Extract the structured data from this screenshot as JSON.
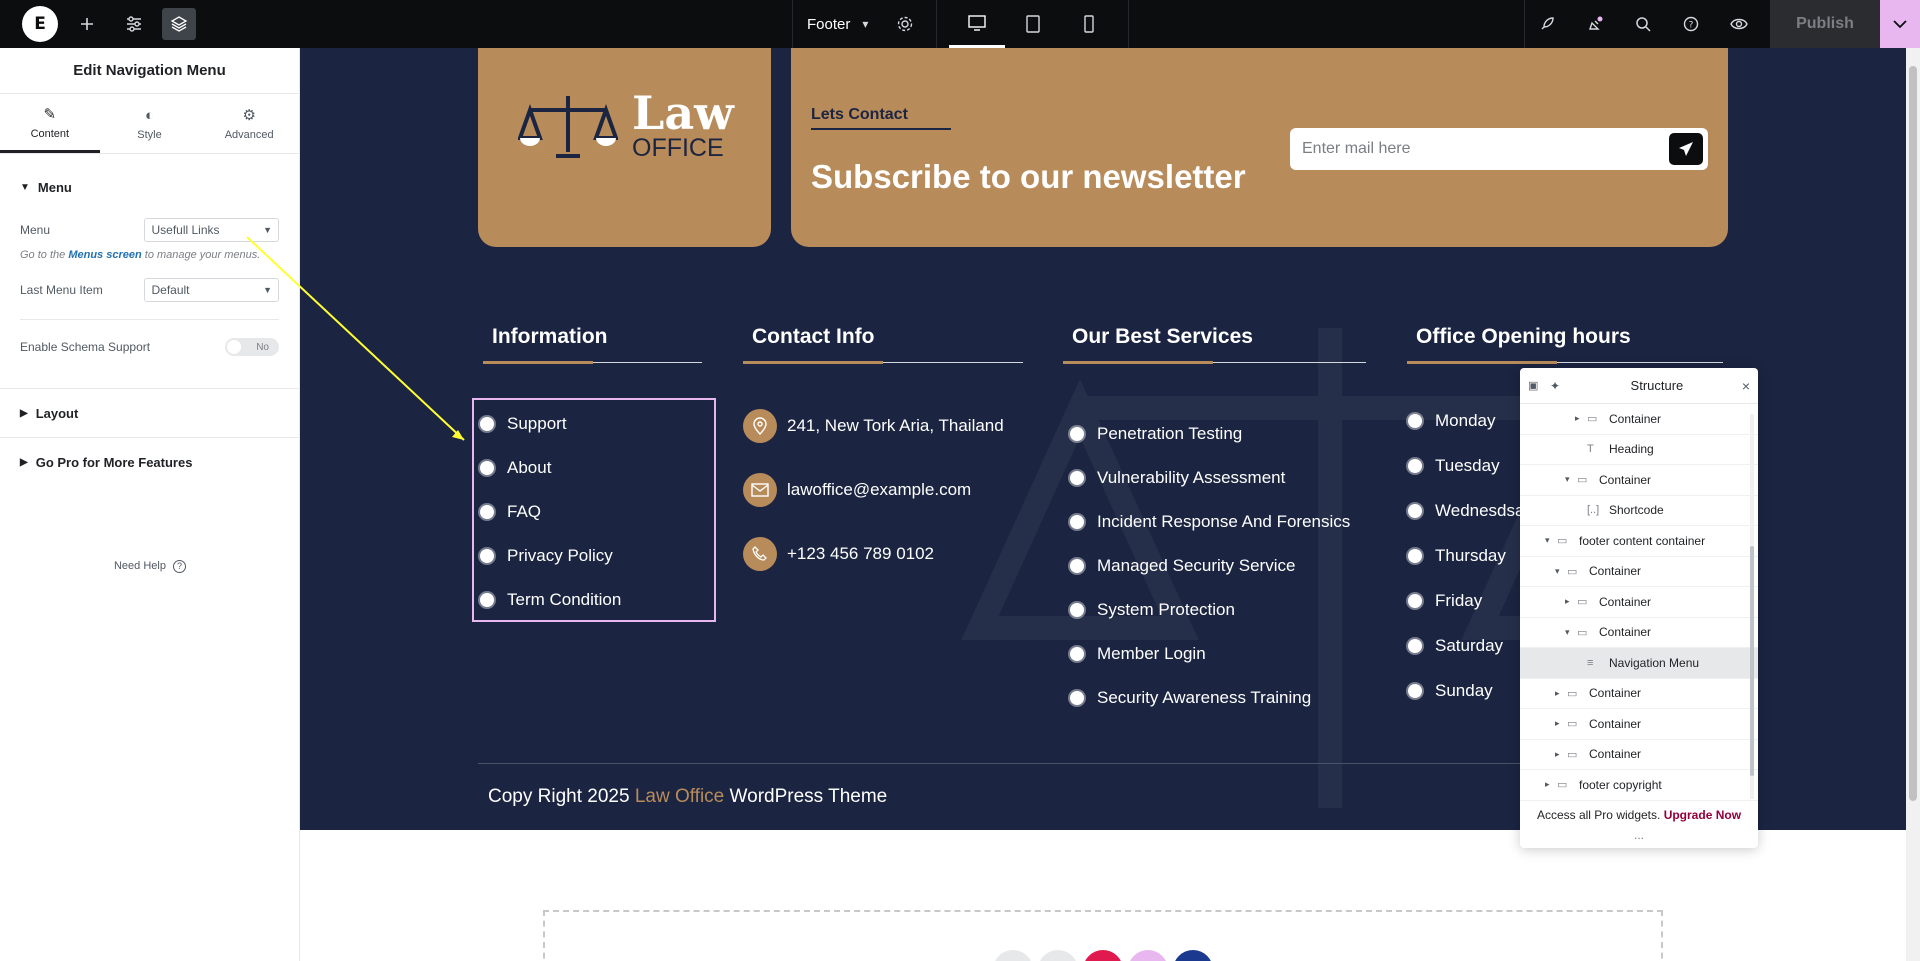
{
  "topbar": {
    "logo": "E",
    "doc_title": "Footer",
    "publish_label": "Publish"
  },
  "panel": {
    "title": "Edit Navigation Menu",
    "tabs": [
      {
        "label": "Content",
        "icon": "pencil-icon",
        "active": true
      },
      {
        "label": "Style",
        "icon": "half-circle-icon",
        "active": false
      },
      {
        "label": "Advanced",
        "icon": "gear-icon",
        "active": false
      }
    ],
    "menu_section": "Menu",
    "menu_label": "Menu",
    "menu_value": "Usefull Links",
    "desc_pre": "Go to the",
    "desc_link": "Menus screen",
    "desc_post": "to manage your menus.",
    "last_item_label": "Last Menu Item",
    "last_item_value": "Default",
    "schema_label": "Enable Schema Support",
    "schema_toggle": "No",
    "layout_section": "Layout",
    "pro_section": "Go Pro for More Features",
    "need_help": "Need Help"
  },
  "footer": {
    "logo_law": "Law",
    "logo_office": "OFFICE",
    "lets_contact": "Lets Contact",
    "subscribe_title": "Subscribe to our newsletter",
    "email_placeholder": "Enter mail here",
    "columns": {
      "information": {
        "title": "Information",
        "items": [
          "Support",
          "About",
          "FAQ",
          "Privacy Policy",
          "Term Condition"
        ]
      },
      "contact": {
        "title": "Contact Info",
        "items": [
          {
            "icon": "location-pin-icon",
            "text": "241, New Tork Aria, Thailand"
          },
          {
            "icon": "envelope-icon",
            "text": "lawoffice@example.com"
          },
          {
            "icon": "phone-icon",
            "text": "+123 456 789 0102"
          }
        ]
      },
      "services": {
        "title": "Our Best Services",
        "items": [
          "Penetration Testing",
          "Vulnerability Assessment",
          "Incident Response And Forensics",
          "Managed Security Service",
          "System Protection",
          "Member Login",
          "Security Awareness Training"
        ]
      },
      "hours": {
        "title": "Office Opening hours",
        "items": [
          "Monday",
          "Tuesday",
          "Wednesdsa",
          "Thursday",
          "Friday",
          "Saturday",
          "Sunday"
        ]
      }
    },
    "copyright_pre": "Copy Right 2025",
    "copyright_brand": "Law Office",
    "copyright_post": "WordPress Theme"
  },
  "structure": {
    "title": "Structure",
    "rows": [
      {
        "label": "Container",
        "arrow": "▸",
        "icon": "container-icon"
      },
      {
        "label": "Heading",
        "arrow": "",
        "icon": "heading-icon"
      },
      {
        "label": "Container",
        "arrow": "▾",
        "icon": "container-icon"
      },
      {
        "label": "Shortcode",
        "arrow": "",
        "icon": "shortcode-icon"
      },
      {
        "label": "footer content container",
        "arrow": "▾",
        "icon": "container-icon"
      },
      {
        "label": "Container",
        "arrow": "▾",
        "icon": "container-icon"
      },
      {
        "label": "Container",
        "arrow": "▸",
        "icon": "container-icon"
      },
      {
        "label": "Container",
        "arrow": "▾",
        "icon": "container-icon"
      },
      {
        "label": "Navigation Menu",
        "arrow": "",
        "icon": "menu-icon",
        "selected": true
      },
      {
        "label": "Container",
        "arrow": "▸",
        "icon": "container-icon"
      },
      {
        "label": "Container",
        "arrow": "▸",
        "icon": "container-icon"
      },
      {
        "label": "Container",
        "arrow": "▸",
        "icon": "container-icon"
      },
      {
        "label": "footer copyright",
        "arrow": "▸",
        "icon": "container-icon"
      }
    ],
    "footer_text": "Access all Pro widgets.",
    "upgrade_label": "Upgrade Now",
    "more": "..."
  },
  "colors": {
    "footer_bg": "#1b2441",
    "accent_gold": "#b88b5a",
    "selection_pink": "#e9b7f0",
    "arrow_yellow": "#ffff33"
  }
}
